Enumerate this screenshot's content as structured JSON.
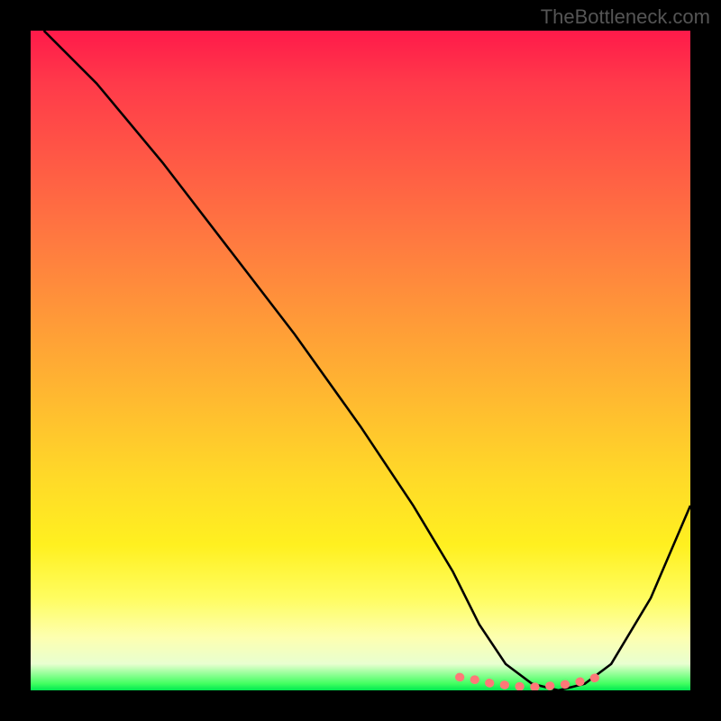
{
  "watermark": "TheBottleneck.com",
  "chart_data": {
    "type": "line",
    "title": "",
    "xlabel": "",
    "ylabel": "",
    "xlim": [
      0,
      100
    ],
    "ylim": [
      0,
      100
    ],
    "grid": false,
    "legend": false,
    "background_gradient": {
      "top_color": "#ff1a4a",
      "bottom_color": "#00e850",
      "meaning": "bottleneck severity (red=high, green=low)"
    },
    "series": [
      {
        "name": "bottleneck-curve",
        "color": "#000000",
        "x": [
          2,
          10,
          20,
          30,
          40,
          50,
          58,
          64,
          68,
          72,
          76,
          80,
          84,
          88,
          94,
          100
        ],
        "y": [
          100,
          92,
          80,
          67,
          54,
          40,
          28,
          18,
          10,
          4,
          1,
          0,
          1,
          4,
          14,
          28
        ]
      },
      {
        "name": "optimal-zone-highlight",
        "color": "#ff7a7a",
        "type": "scatter",
        "x": [
          65,
          68,
          70,
          72,
          74,
          76,
          78,
          80,
          82,
          84,
          86
        ],
        "y": [
          2,
          1.5,
          1,
          0.8,
          0.6,
          0.5,
          0.6,
          0.8,
          1,
          1.5,
          2
        ]
      }
    ]
  }
}
